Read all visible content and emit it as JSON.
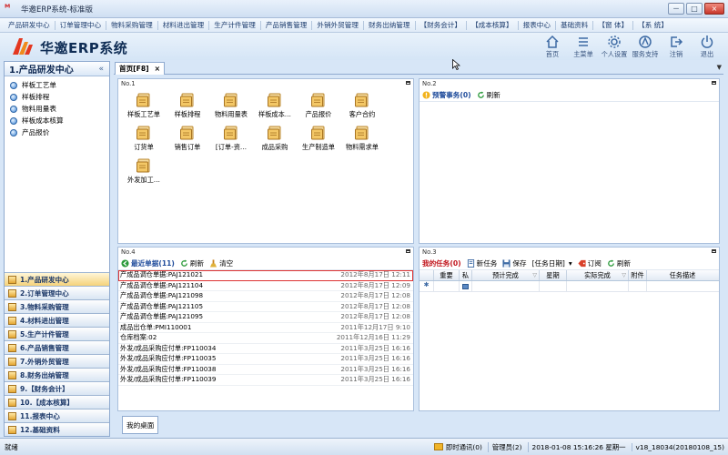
{
  "window": {
    "title": "华邀ERP系统-标准版",
    "buttons": [
      "－",
      "□",
      "×"
    ]
  },
  "menu": [
    "产品研发中心",
    "订单管理中心",
    "物料采购管理",
    "材料进出管理",
    "生产计件管理",
    "产品销售管理",
    "外销外贸管理",
    "财务出纳管理",
    "【财务会计】",
    "【成本核算】",
    "报表中心",
    "基础资料",
    "【窗 体】",
    "【系 统】"
  ],
  "brand": {
    "name": "华邀ERP系统"
  },
  "tools": [
    {
      "label": "首页",
      "icon": "home-icon"
    },
    {
      "label": "主菜单",
      "icon": "list-icon"
    },
    {
      "label": "个人设置",
      "icon": "gear-icon"
    },
    {
      "label": "服务支持",
      "icon": "support-icon"
    },
    {
      "label": "注销",
      "icon": "logout-icon"
    },
    {
      "label": "退出",
      "icon": "power-icon"
    }
  ],
  "sidebar": {
    "title": "1.产品研发中心",
    "collapse": "«",
    "items": [
      "样板工艺单",
      "样板排程",
      "物料用量表",
      "样板成本核算",
      "产品报价"
    ],
    "modules": [
      "1.产品研发中心",
      "2.订单管理中心",
      "3.物料采购管理",
      "4.材料进出管理",
      "5.生产计件管理",
      "6.产品销售管理",
      "7.外销外贸管理",
      "8.财务出纳管理",
      "9.【财务会计】",
      "10.【成本核算】",
      "11.报表中心",
      "12.基础资料"
    ]
  },
  "tab": {
    "label": "首页[F8]",
    "close": "×"
  },
  "panel1": {
    "name": "No.1",
    "icons": [
      "样板工艺单",
      "样板排程",
      "物料用量表",
      "样板成本…",
      "产品报价",
      "客户合约",
      "订货单",
      "销售订单",
      "[订单-资…",
      "成品采购",
      "生产制造单",
      "物料需求单",
      "外发加工…"
    ]
  },
  "panel2": {
    "name": "No.2",
    "alert_label": "预警事务(0)",
    "refresh_label": "刷新"
  },
  "panel4": {
    "name": "No.4",
    "recent_label": "最近单据(11)",
    "refresh_label": "刷新",
    "clear_label": "清空",
    "rows": [
      {
        "doc": "产成品调仓单据:PAJ121021",
        "time": "2012年8月17日  12:11"
      },
      {
        "doc": "产成品调仓单据:PAJ121104",
        "time": "2012年8月17日  12:09"
      },
      {
        "doc": "产成品调仓单据:PAJ121098",
        "time": "2012年8月17日  12:08"
      },
      {
        "doc": "产成品调仓单据:PAJ121105",
        "time": "2012年8月17日  12:08"
      },
      {
        "doc": "产成品调仓单据:PAJ121095",
        "time": "2012年8月17日  12:08"
      },
      {
        "doc": "成品出仓单:PMI110001",
        "time": "2011年12月17日  9:10"
      },
      {
        "doc": "仓库档案:02",
        "time": "2011年12月16日  11:29"
      },
      {
        "doc": "外发/成品采购应付单:FP110034",
        "time": "2011年3月25日  16:16"
      },
      {
        "doc": "外发/成品采购应付单:FP110035",
        "time": "2011年3月25日  16:16"
      },
      {
        "doc": "外发/成品采购应付单:FP110038",
        "time": "2011年3月25日  16:16"
      },
      {
        "doc": "外发/成品采购应付单:FP110039",
        "time": "2011年3月25日  16:16"
      }
    ]
  },
  "panel3": {
    "name": "No.3",
    "mytask_label": "我的任务(0)",
    "new_label": "新任务",
    "save_label": "保存",
    "taskdate_label": "[任务日期]",
    "dropdown": "▾",
    "subscribe_label": "订阅",
    "refresh_label": "刷新",
    "columns": [
      "重要",
      "私",
      "预计完成",
      "星期",
      "实际完成",
      "附件",
      "任务描述"
    ],
    "new_row_marker": "✱"
  },
  "bottom_tab": "我的桌面",
  "status": {
    "left": "就绪",
    "messenger": "即时通讯(0)",
    "user": "管理员(2)",
    "datetime": "2018-01-08  15:16:26  星期一",
    "version": "v18_18034(20180108_15)"
  },
  "colors": {
    "accent": "#2e66a8",
    "alert": "#c0131b",
    "panel_bg": "#d7e6f7"
  }
}
